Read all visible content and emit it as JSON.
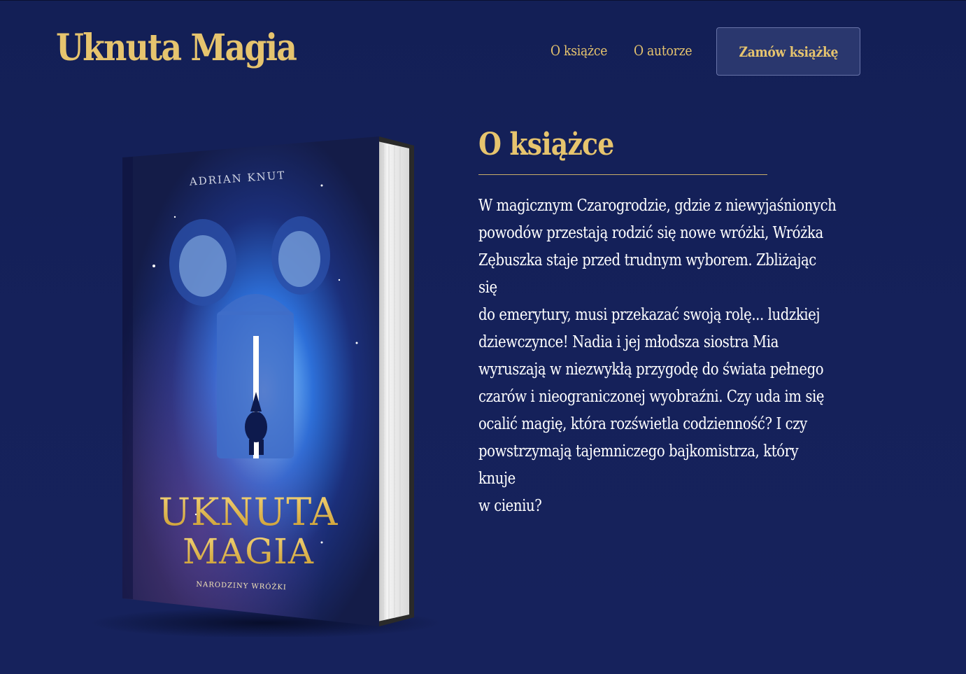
{
  "header": {
    "logo": "Uknuta Magia",
    "nav": {
      "about_book": "O książce",
      "about_author": "O autorze"
    },
    "order_button": "Zamów książkę"
  },
  "book_cover": {
    "author": "ADRIAN KNUT",
    "title_line1": "UKNUTA",
    "title_line2": "MAGIA",
    "subtitle": "NARODZINY WRÓŻKI"
  },
  "about": {
    "title": "O książce",
    "description_lines": [
      "W magicznym Czarogrodzie, gdzie z niewyjaśnionych",
      "powodów przestają rodzić się nowe wróżki, Wróżka",
      "Zębuszka staje przed trudnym wyborem. Zbliżając się",
      "do emerytury, musi przekazać swoją rolę... ludzkiej",
      "dziewczynce! Nadia i jej młodsza siostra Mia",
      "wyruszają w niezwykłą przygodę do świata pełnego",
      "czarów i nieograniczonej wyobraźni. Czy uda im się",
      "ocalić magię, która rozświetla codzienność? I czy",
      "powstrzymają tajemniczego bajkomistrza, który knuje",
      "w cieniu?"
    ]
  },
  "colors": {
    "background": "#15215a",
    "accent_gold": "#e6c46e",
    "button_bg": "#2a376e",
    "text": "#ffffff"
  }
}
